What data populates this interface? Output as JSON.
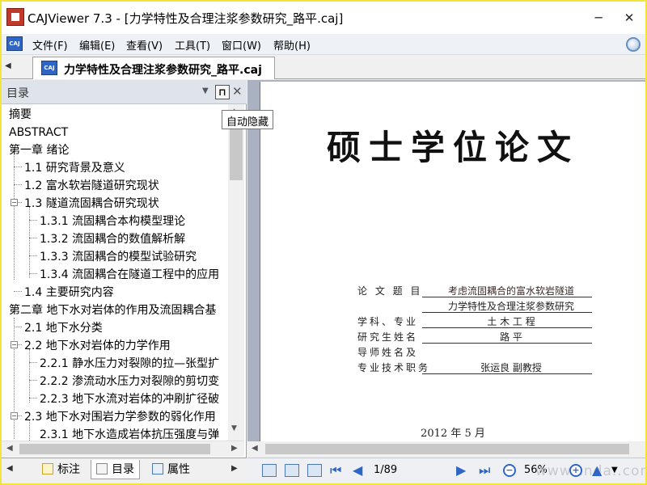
{
  "window": {
    "title": "CAJViewer 7.3 - [力学特性及合理注浆参数研究_路平.caj]",
    "minimize_label": "─",
    "close_label": "✕"
  },
  "menu": {
    "items": [
      "文件(F)",
      "编辑(E)",
      "查看(V)",
      "工具(T)",
      "窗口(W)",
      "帮助(H)"
    ]
  },
  "tabs": {
    "document_tab": "力学特性及合理注浆参数研究_路平.caj"
  },
  "sidebar": {
    "title": "目录",
    "tooltip": "自动隐藏",
    "toc": [
      {
        "text": "摘要"
      },
      {
        "text": "ABSTRACT"
      },
      {
        "text": "第一章 绪论"
      },
      {
        "text": "1.1 研究背景及意义"
      },
      {
        "text": "1.2 富水软岩隧道研究现状"
      },
      {
        "text": "1.3 隧道流固耦合研究现状"
      },
      {
        "text": "1.3.1 流固耦合本构模型理论"
      },
      {
        "text": "1.3.2 流固耦合的数值解析解"
      },
      {
        "text": "1.3.3 流固耦合的模型试验研究"
      },
      {
        "text": "1.3.4 流固耦合在隧道工程中的应用"
      },
      {
        "text": "1.4 主要研究内容"
      },
      {
        "text": "第二章 地下水对岩体的作用及流固耦合基"
      },
      {
        "text": "2.1 地下水分类"
      },
      {
        "text": "2.2 地下水对岩体的力学作用"
      },
      {
        "text": "2.2.1 静水压力对裂隙的拉—张型扩"
      },
      {
        "text": "2.2.2 渗流动水压力对裂隙的剪切变"
      },
      {
        "text": "2.2.3 地下水流对岩体的冲刷扩径破"
      },
      {
        "text": "2.3 地下水对围岩力学参数的弱化作用"
      },
      {
        "text": "2.3.1 地下水造成岩体抗压强度与弹"
      }
    ],
    "bottom_tabs": [
      "标注",
      "目录",
      "属性"
    ]
  },
  "document": {
    "page_title": "硕士学位论文",
    "form": [
      {
        "label": "论 文 题 目",
        "value": "考虑流固耦合的富水软岩隧道"
      },
      {
        "label": "",
        "value": "力学特性及合理注浆参数研究"
      },
      {
        "label": "学科、专业",
        "value": "土 木 工 程"
      },
      {
        "label": "研究生姓名",
        "value": "路 平"
      },
      {
        "label": "导师姓名及",
        "value": ""
      },
      {
        "label": "专业技术职务",
        "value": "张运良 副教授"
      }
    ],
    "date": "2012 年 5 月"
  },
  "status": {
    "page_indicator": "1/89",
    "zoom": "56%",
    "watermark": "www.cnda..com"
  },
  "colors": {
    "accent": "#2f66c6",
    "window_border": "#f2e53a",
    "document_background": "#aab2c2"
  }
}
